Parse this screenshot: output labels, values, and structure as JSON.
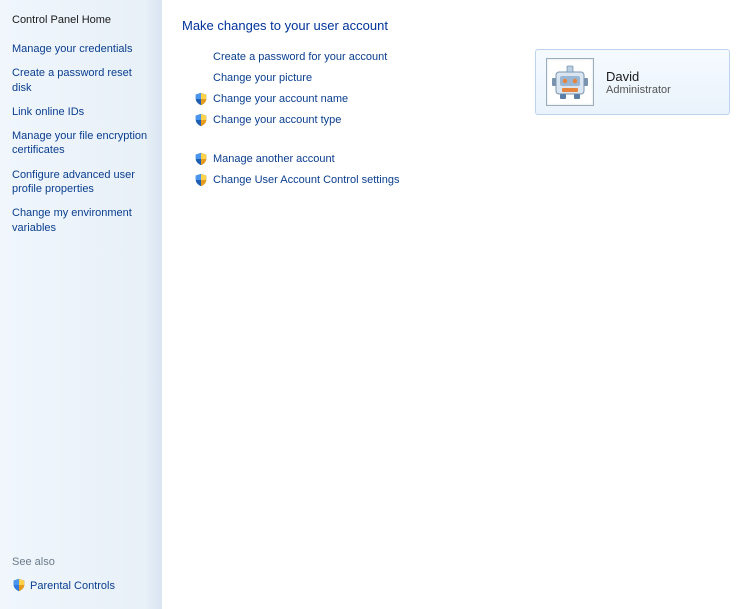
{
  "sidebar": {
    "home_label": "Control Panel Home",
    "links": [
      "Manage your credentials",
      "Create a password reset disk",
      "Link online IDs",
      "Manage your file encryption certificates",
      "Configure advanced user profile properties",
      "Change my environment variables"
    ],
    "see_also_label": "See also",
    "bottom_link": "Parental Controls"
  },
  "main": {
    "heading": "Make changes to your user account",
    "actions_group1": [
      {
        "label": "Create a password for your account",
        "shield": false
      },
      {
        "label": "Change your picture",
        "shield": false
      },
      {
        "label": "Change your account name",
        "shield": true
      },
      {
        "label": "Change your account type",
        "shield": true
      }
    ],
    "actions_group2": [
      {
        "label": "Manage another account",
        "shield": true
      },
      {
        "label": "Change User Account Control settings",
        "shield": true
      }
    ]
  },
  "account": {
    "name": "David",
    "role": "Administrator"
  }
}
